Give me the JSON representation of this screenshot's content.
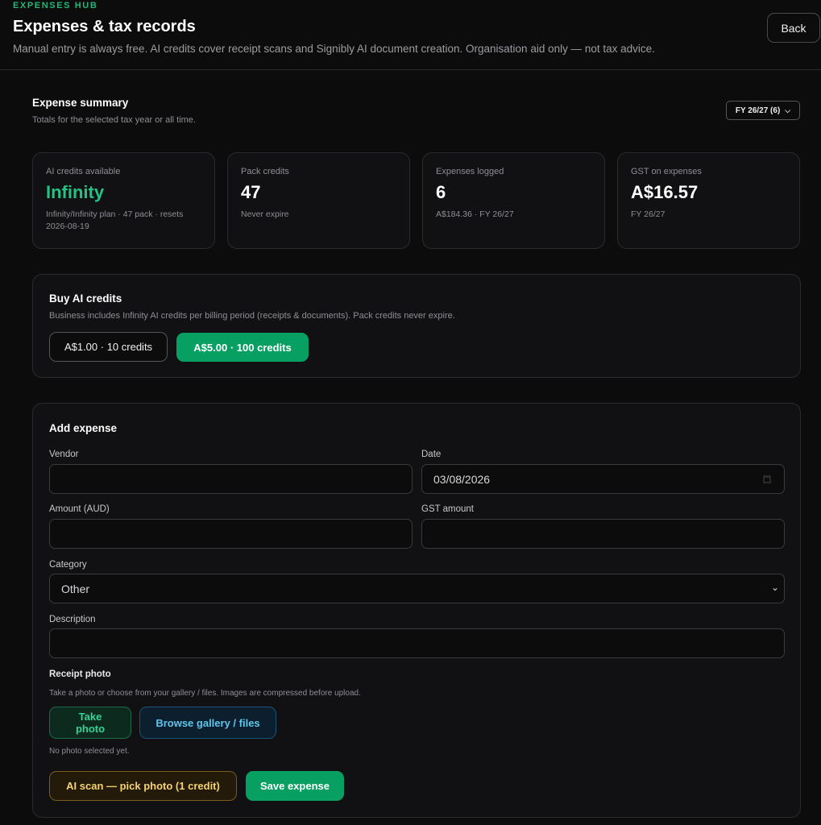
{
  "header": {
    "eyebrow": "EXPENSES HUB",
    "title": "Expenses & tax records",
    "subtitle": "Manual entry is always free. AI credits cover receipt scans and Signibly AI document creation. Organisation aid only — not tax advice.",
    "back_label": "Back"
  },
  "summary": {
    "title": "Expense summary",
    "subtitle": "Totals for the selected tax year or all time.",
    "year_select": "FY 26/27 (6)"
  },
  "stats": [
    {
      "label": "AI credits available",
      "value": "Infinity",
      "note": "Infinity/Infinity plan · 47 pack · resets 2026-08-19"
    },
    {
      "label": "Pack credits",
      "value": "47",
      "note": "Never expire"
    },
    {
      "label": "Expenses logged",
      "value": "6",
      "note": "A$184.36 · FY 26/27"
    },
    {
      "label": "GST on expenses",
      "value": "A$16.57",
      "note": "FY 26/27"
    }
  ],
  "buy": {
    "title": "Buy AI credits",
    "subtitle": "Business includes Infinity AI credits per billing period (receipts & documents). Pack credits never expire.",
    "option_small": "A$1.00 · 10 credits",
    "option_large": "A$5.00 · 100 credits"
  },
  "form": {
    "title": "Add expense",
    "vendor_label": "Vendor",
    "vendor_value": "",
    "date_label": "Date",
    "date_value": "03/08/2026",
    "amount_label": "Amount (AUD)",
    "amount_value": "",
    "gst_label": "GST amount",
    "gst_value": "",
    "category_label": "Category",
    "category_value": "Other",
    "description_label": "Description",
    "description_value": "",
    "receipt_label": "Receipt photo",
    "receipt_note": "Take a photo or choose from your gallery / files. Images are compressed before upload.",
    "take_photo": "Take photo",
    "browse": "Browse gallery / files",
    "no_photo": "No photo selected yet.",
    "ai_scan": "AI scan — pick photo (1 credit)",
    "save": "Save expense"
  }
}
